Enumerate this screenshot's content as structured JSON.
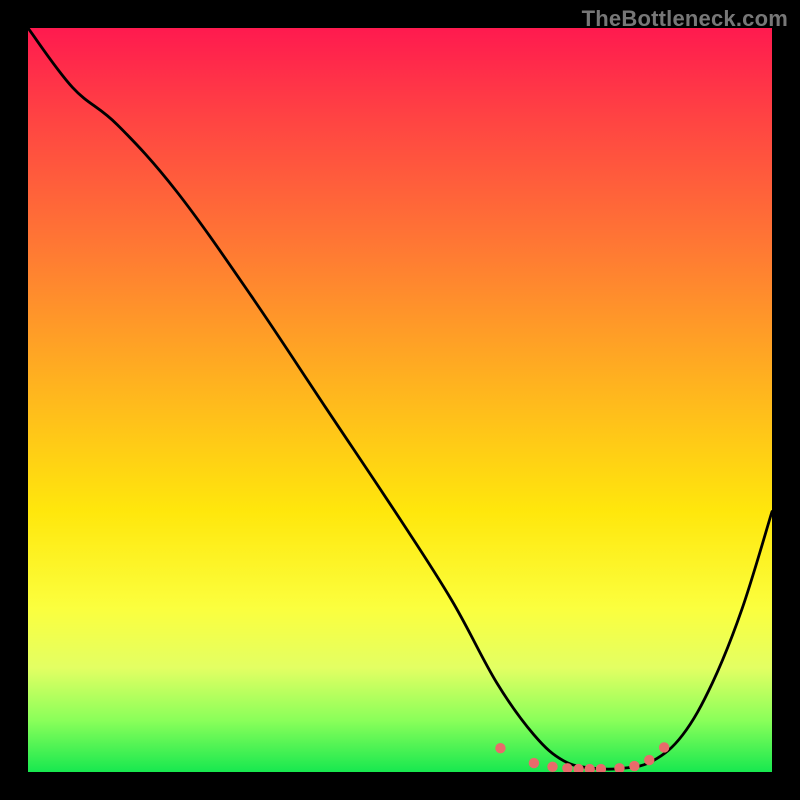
{
  "watermark": {
    "text": "TheBottleneck.com"
  },
  "colors": {
    "curve": "#000000",
    "dot_fill": "#e86b6b",
    "dot_stroke": "#b94a4a",
    "background_black": "#000000"
  },
  "chart_data": {
    "type": "line",
    "title": "",
    "xlabel": "",
    "ylabel": "",
    "xlim": [
      0,
      100
    ],
    "ylim": [
      0,
      100
    ],
    "grid": false,
    "legend": false,
    "series": [
      {
        "name": "bottleneck-curve",
        "x": [
          0,
          6,
          12,
          20,
          30,
          40,
          50,
          57,
          63,
          68,
          72,
          76,
          80,
          84,
          88,
          92,
          96,
          100
        ],
        "y": [
          100,
          92,
          87,
          78,
          64,
          49,
          34,
          23,
          12,
          5,
          1.5,
          0.5,
          0.5,
          1.5,
          5,
          12,
          22,
          35
        ]
      }
    ],
    "dots": {
      "name": "highlight-dots",
      "x": [
        63.5,
        68,
        70.5,
        72.5,
        74,
        75.5,
        77,
        79.5,
        81.5,
        83.5,
        85.5
      ],
      "y": [
        3.2,
        1.2,
        0.7,
        0.5,
        0.4,
        0.4,
        0.4,
        0.5,
        0.8,
        1.6,
        3.3
      ]
    }
  }
}
